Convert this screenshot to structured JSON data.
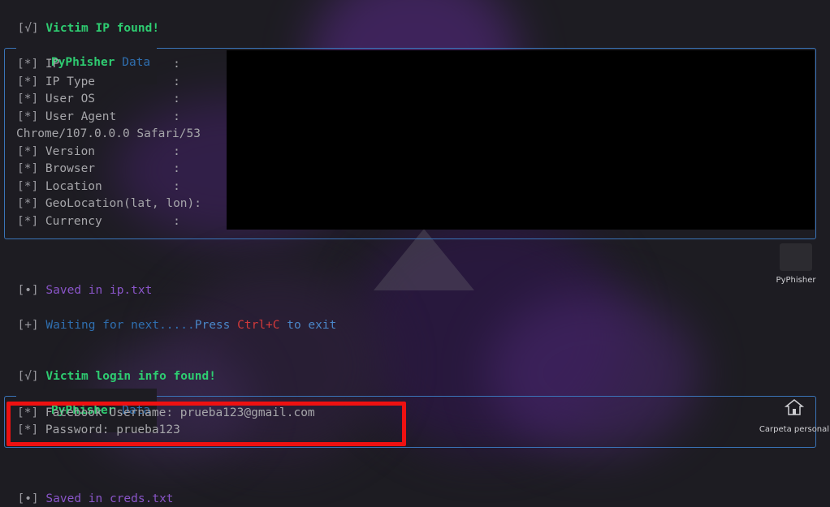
{
  "ip_found": {
    "bracket": "[√]",
    "text": "Victim IP found!"
  },
  "ip_panel": {
    "title_bold": "PyPhisher",
    "title_rest": " Data",
    "rows": [
      {
        "mark": "[*]",
        "label": " IP                :"
      },
      {
        "mark": "[*]",
        "label": " IP Type           :"
      },
      {
        "mark": "[*]",
        "label": " User OS           :"
      },
      {
        "mark": "[*]",
        "label": " User Agent        :"
      },
      {
        "mark": "",
        "label": "Chrome/107.0.0.0 Safari/53"
      },
      {
        "mark": "[*]",
        "label": " Version           :"
      },
      {
        "mark": "[*]",
        "label": " Browser           :"
      },
      {
        "mark": "[*]",
        "label": " Location          :"
      },
      {
        "mark": "[*]",
        "label": " GeoLocation(lat, lon):"
      },
      {
        "mark": "[*]",
        "label": " Currency          :"
      }
    ]
  },
  "saved_ip": {
    "bracket": "[•]",
    "text": " Saved in ip.txt"
  },
  "waiting": {
    "bracket": "[+]",
    "part1": " Waiting for next.....",
    "part2": "Press ",
    "part3": "Ctrl+C",
    "part4": " to exit"
  },
  "login_found": {
    "bracket": "[√]",
    "text": "Victim login info found!"
  },
  "cred_panel": {
    "title_bold": "PyPhisher",
    "title_rest": " Data",
    "rows": [
      {
        "mark": "[*]",
        "label": " Facebook Username: prueba123@gmail.com"
      },
      {
        "mark": "[*]",
        "label": " Password: prueba123"
      }
    ]
  },
  "saved_creds": {
    "bracket": "[•]",
    "text": " Saved in creds.txt"
  },
  "desktop": {
    "pyphisher_label": "PyPhisher",
    "home_label": "Carpeta personal"
  },
  "colors": {
    "accent_green": "#2ecc71",
    "panel_border": "#3a74b8",
    "highlight": "#ee1111",
    "purple": "#8a55c9"
  }
}
